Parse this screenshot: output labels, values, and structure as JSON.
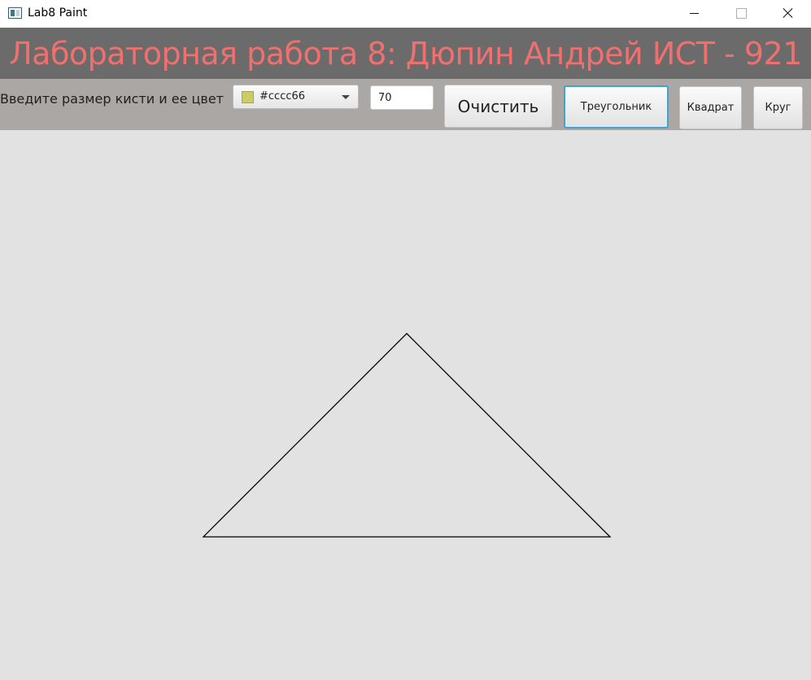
{
  "window": {
    "title": "Lab8 Paint",
    "icon": "app-window-icon",
    "controls": [
      "minimize-icon",
      "maximize-icon",
      "close-icon"
    ]
  },
  "header": {
    "title": "Лабораторная работа 8: Дюпин Андрей ИСТ - 921",
    "title_color": "#f07070",
    "background": "#6b6b6b"
  },
  "toolbar": {
    "brush_label": "Введите размер кисти и ее цвет",
    "color_picker": {
      "value": "#cccc66",
      "swatch_color": "#cccc66"
    },
    "brush_size": "70",
    "buttons": {
      "clear": "Очистить",
      "triangle": "Треугольник",
      "square": "Квадрат",
      "circle": "Круг"
    },
    "selected_button": "triangle",
    "background": "#aaa7a5"
  },
  "canvas": {
    "background": "#e2e2e2",
    "shape": "triangle",
    "stroke_color": "#000000"
  }
}
